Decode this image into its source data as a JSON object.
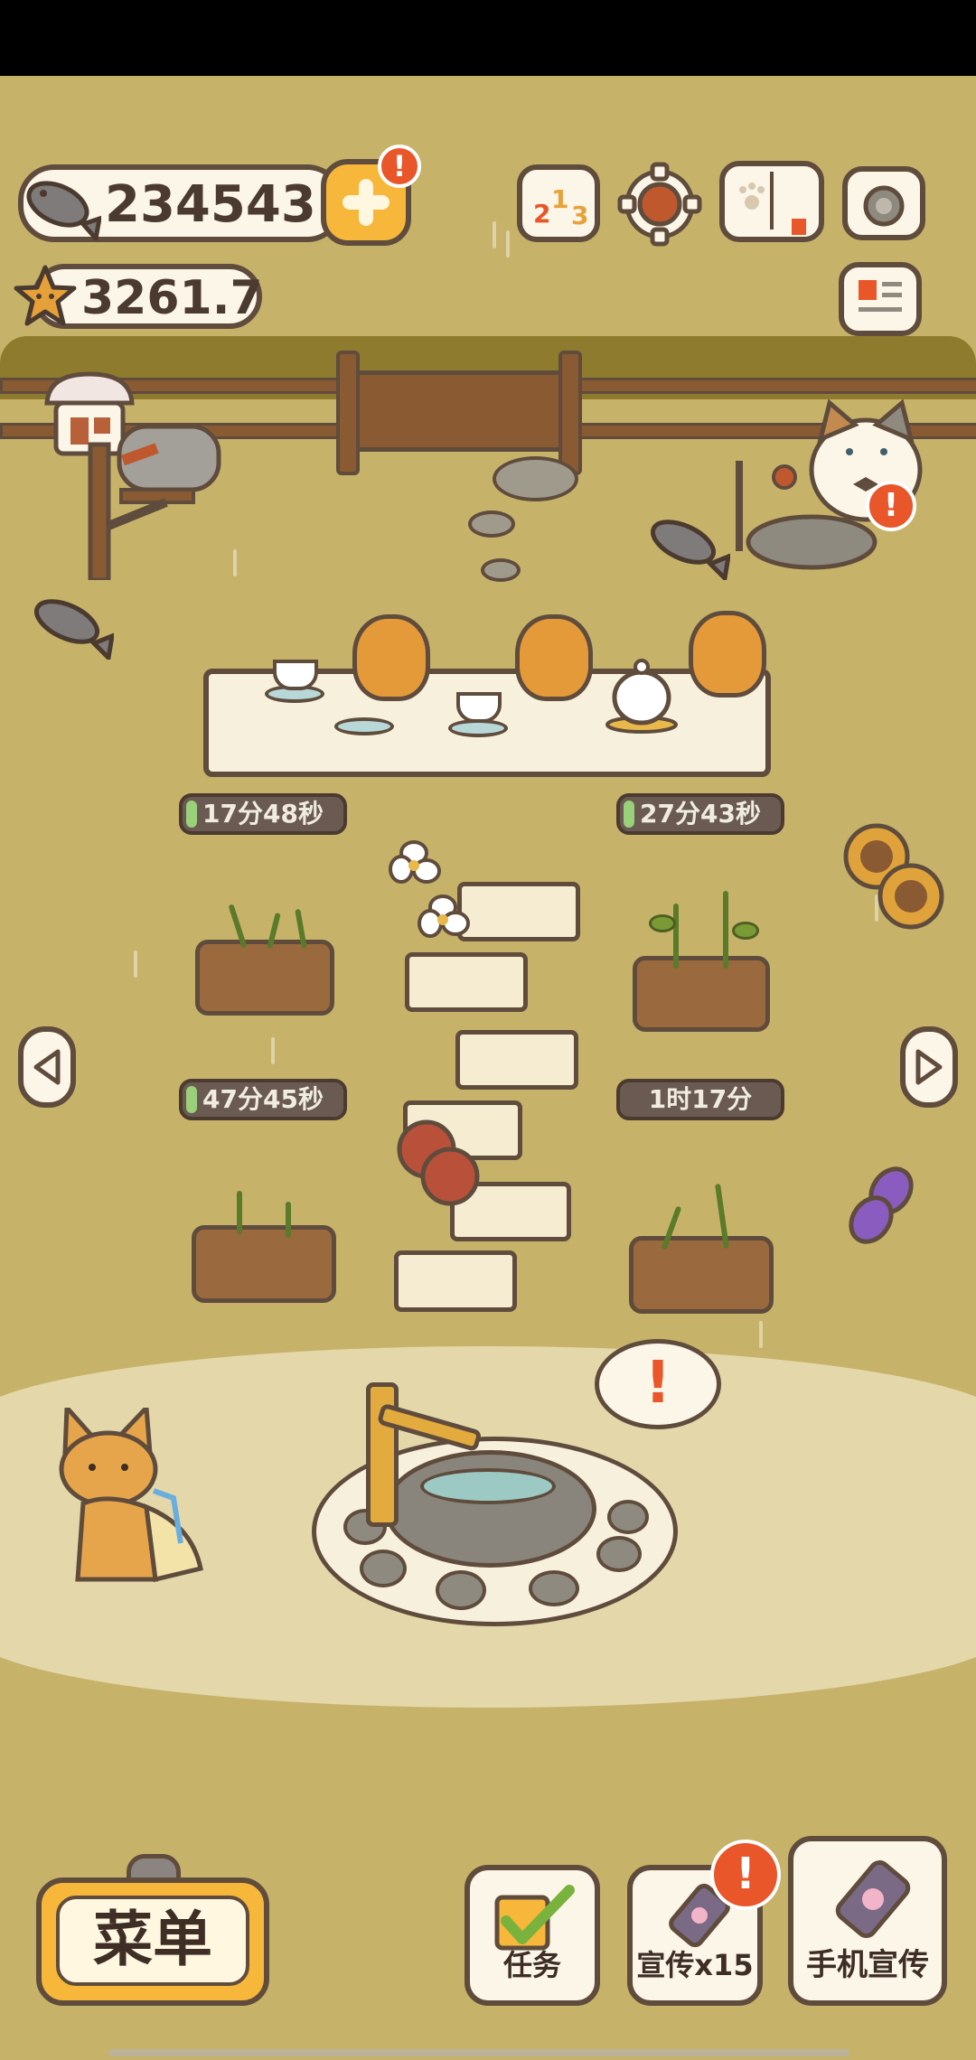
{
  "currency": {
    "fish_value": "234543",
    "star_value": "3261.7"
  },
  "timers": {
    "top_left": "17分48秒",
    "top_right": "27分43秒",
    "mid_left": "47分45秒",
    "mid_right": "1时17分"
  },
  "bubble": {
    "mark": "!"
  },
  "bottom": {
    "menu_label": "菜单",
    "task_label": "任务",
    "promo_label": "宣传x15",
    "phone_promo_label": "手机宣传"
  },
  "icons": {
    "fish": "fish-icon",
    "star": "star-icon",
    "plus": "plus-icon",
    "ranking": "ranking-podium-icon",
    "settings": "gear-icon",
    "book": "paw-book-icon",
    "camera": "camera-icon",
    "news": "newspaper-icon"
  },
  "colors": {
    "ground": "#c7b26a",
    "path": "#e4d8aa",
    "accent_orange": "#f6b73a",
    "alert_red": "#e8562a",
    "outline": "#5f4c3c"
  }
}
